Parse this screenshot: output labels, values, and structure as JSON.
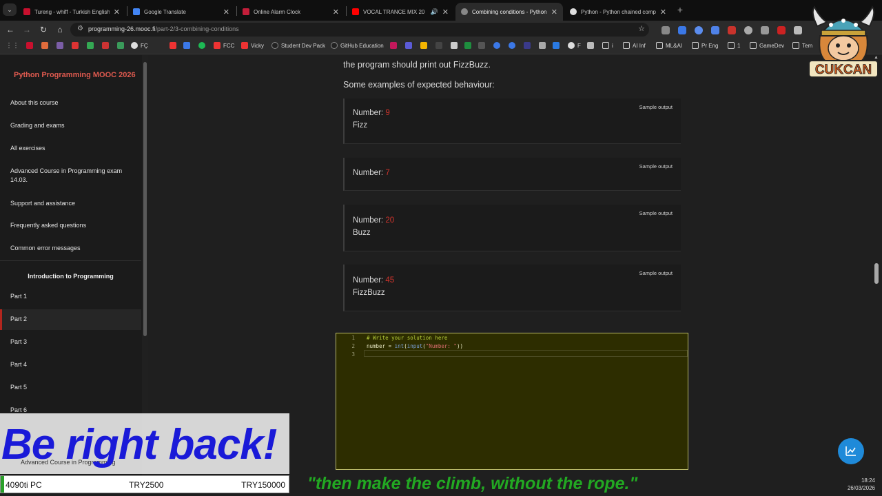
{
  "browser": {
    "tabs": [
      {
        "title": "Tureng - whiff - Turkish English",
        "favicon_color": "#c8102e"
      },
      {
        "title": "Google Translate",
        "favicon_color": "#4285f4"
      },
      {
        "title": "Online Alarm Clock",
        "favicon_color": "#c41e3a"
      },
      {
        "title": "VOCAL TRANCE MIX 20",
        "favicon_color": "#ff0000"
      },
      {
        "title": "Combining conditions - Python",
        "favicon_color": "#888888"
      },
      {
        "title": "Python - Python chained comp",
        "favicon_color": "#dddddd"
      }
    ],
    "url_host": "programming-26.mooc.fi",
    "url_path": "/part-2/3-combining-conditions",
    "bookmarks": [
      "FÇ",
      "FCC",
      "Vicky",
      "Student Dev Pack",
      "GitHub Education",
      "F",
      "i",
      "AI Inf",
      "ML&AI",
      "Pr Eng",
      "1",
      "GameDev",
      "Tem"
    ]
  },
  "sidebar": {
    "title": "Python Programming MOOC 2026",
    "items": [
      "About this course",
      "Grading and exams",
      "All exercises",
      "Advanced Course in Programming exam 14.03.",
      "Support and assistance",
      "Frequently asked questions",
      "Common error messages"
    ],
    "section": "Introduction to Programming",
    "parts": [
      "Part 1",
      "Part 2",
      "Part 3",
      "Part 4",
      "Part 5",
      "Part 6"
    ],
    "active_part": "Part 2",
    "bottom_item": "Advanced Course in Programming"
  },
  "content": {
    "intro_tail": "the program should print out FizzBuzz.",
    "examples_heading": "Some examples of expected behaviour:",
    "sample_label": "Sample output",
    "prompt": "Number:",
    "samples": [
      {
        "input": "9",
        "output": "Fizz"
      },
      {
        "input": "7",
        "output": ""
      },
      {
        "input": "20",
        "output": "Buzz"
      },
      {
        "input": "45",
        "output": "FizzBuzz"
      }
    ]
  },
  "editor": {
    "line_numbers": [
      "1",
      "2",
      "3"
    ],
    "comment": "# Write your solution here",
    "code_var": "number = ",
    "code_fn1": "int",
    "code_fn2": "input",
    "code_str": "\"Number: \"",
    "code_close": "))"
  },
  "overlay": {
    "brb": "Be right back!",
    "ticker_pc": "4090ti PC",
    "ticker_goal1": "TRY2500",
    "ticker_goal2": "TRY150000",
    "quote": "\"then make the climb, without the rope.\"",
    "logo_text": "CUKCAN",
    "time": "18:24",
    "date": "26/03/2026"
  }
}
